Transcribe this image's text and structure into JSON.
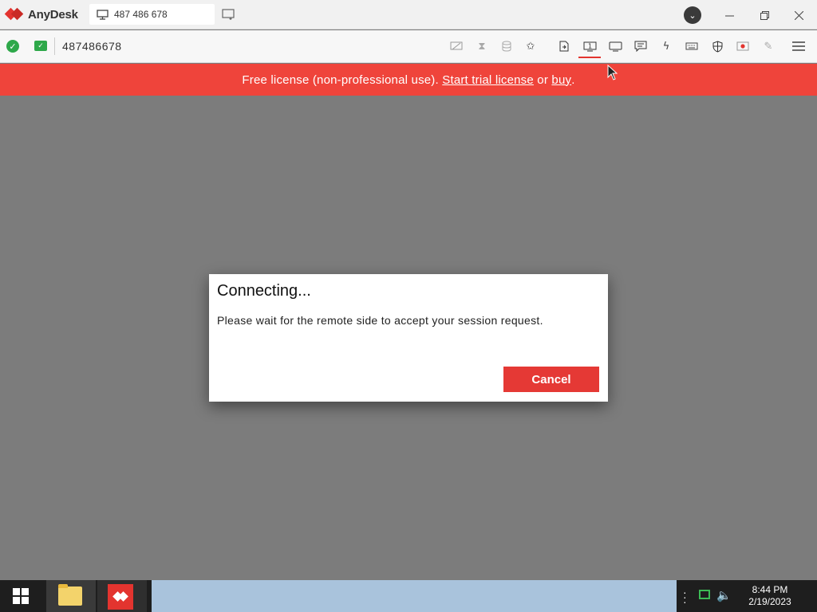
{
  "titlebar": {
    "app_name": "AnyDesk",
    "tab_address": "487 486 678"
  },
  "toolbar": {
    "remote_id": "487486678"
  },
  "banner": {
    "prefix": "Free license (non-professional use). ",
    "trial_link": "Start trial license",
    "middle": " or ",
    "buy_link": "buy",
    "suffix": "."
  },
  "dialog": {
    "title": "Connecting...",
    "message": "Please wait for the remote side to accept your session request.",
    "cancel_label": "Cancel"
  },
  "taskbar": {
    "time": "8:44 PM",
    "date": "2/19/2023"
  },
  "colors": {
    "accent": "#e3342f",
    "banner": "#ef443b",
    "ok_green": "#2ea84a"
  }
}
